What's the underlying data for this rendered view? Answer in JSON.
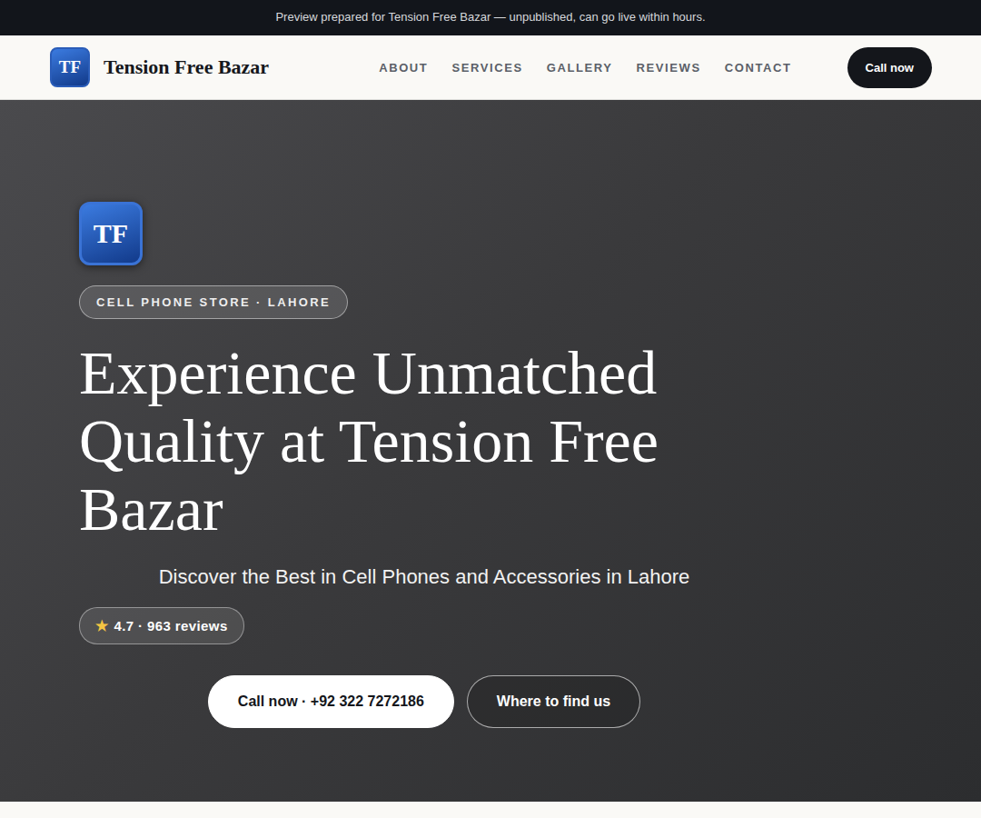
{
  "banner": {
    "text": "Preview prepared for Tension Free Bazar — unpublished, can go live within hours."
  },
  "header": {
    "logo": "TF",
    "brand": "Tension Free Bazar",
    "nav": [
      {
        "label": "ABOUT"
      },
      {
        "label": "SERVICES"
      },
      {
        "label": "GALLERY"
      },
      {
        "label": "REVIEWS"
      },
      {
        "label": "CONTACT"
      }
    ],
    "cta": "Call now"
  },
  "hero": {
    "logo": "TF",
    "eyebrow": "CELL PHONE STORE · LAHORE",
    "title": "Experience Unmatched Quality at Tension Free Bazar",
    "subtitle": "Discover the Best in Cell Phones and Accessories in Lahore",
    "rating": {
      "star": "★",
      "text": "4.7 · 963 reviews"
    },
    "buttons": [
      {
        "label": "Call now · +92 322 7272186",
        "kind": "primary"
      },
      {
        "label": "Where to find us",
        "kind": "outline"
      }
    ]
  }
}
